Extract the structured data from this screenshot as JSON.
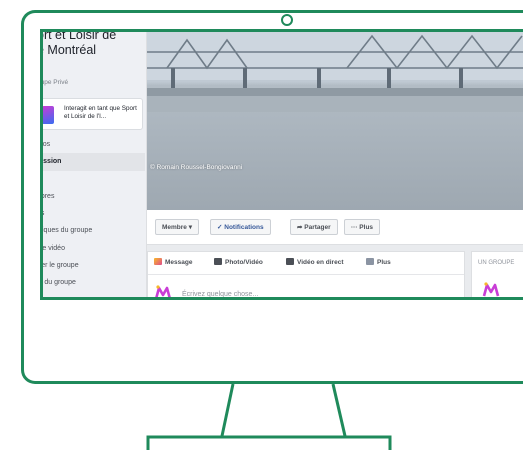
{
  "group": {
    "title_line1": "ort et Loisir de",
    "title_line2": "e Montréal",
    "title_line0": "Sport et Loisir de",
    "type": "oupe Privé"
  },
  "interact": {
    "label": "Interagit en tant que Sport et Loisir de l'I..."
  },
  "nav": {
    "items": [
      {
        "label": "opos",
        "active": false
      },
      {
        "label": "cussion",
        "active": true
      },
      {
        "label": "ns",
        "active": false
      },
      {
        "label": "mbres",
        "active": false
      },
      {
        "label": "tos",
        "active": false
      },
      {
        "label": "istiques du groupe",
        "active": false
      },
      {
        "label": "nce vidéo",
        "active": false
      },
      {
        "label": "érer le groupe",
        "active": false
      },
      {
        "label": "ité du groupe",
        "active": false
      }
    ]
  },
  "cover": {
    "credit": "© Romain Roussel-Bongiovanni"
  },
  "actions": {
    "member": "Membre ▾",
    "notifications": "✓ Notifications",
    "share": "➦ Partager",
    "more": "··· Plus"
  },
  "composer": {
    "tabs": [
      "Message",
      "Photo/Vidéo",
      "Vidéo en direct",
      "Plus"
    ],
    "placeholder": "Écrivez quelque chose..."
  },
  "right_card": {
    "title": "UN GROUPE"
  },
  "colors": {
    "frame": "#1f8a5b",
    "accent_pink": "#c93dd6",
    "accent_blue": "#3a6df0"
  }
}
